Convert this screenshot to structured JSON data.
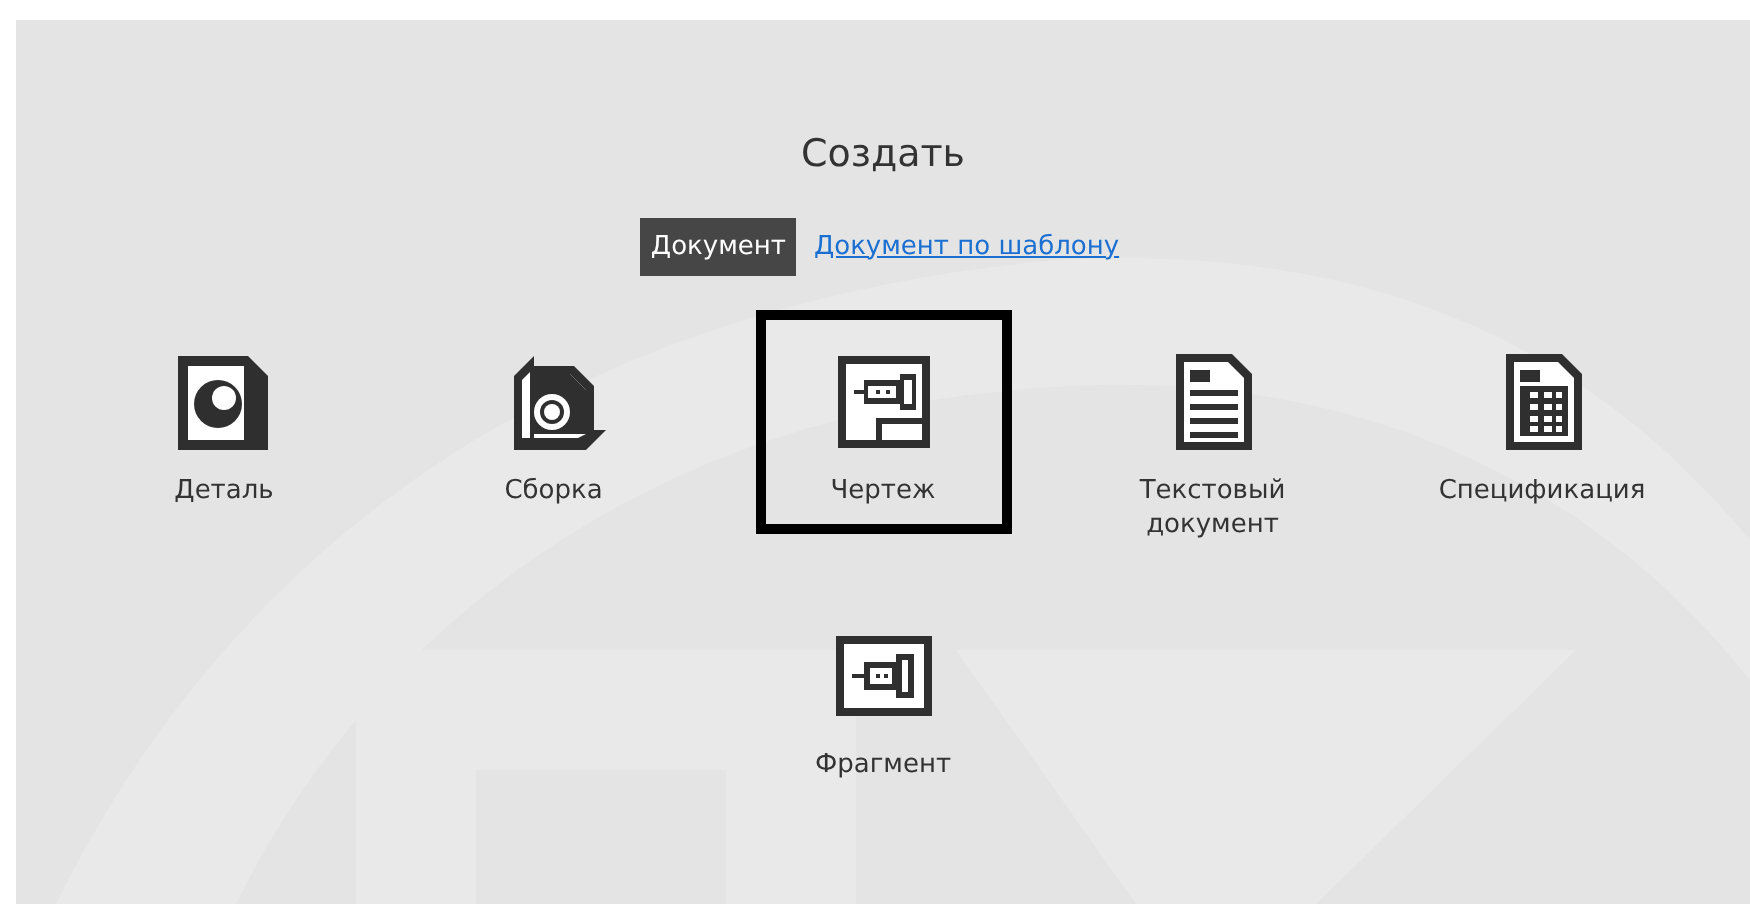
{
  "title": "Создать",
  "tabs": [
    {
      "label": "Документ",
      "selected": true
    },
    {
      "label": "Документ по шаблону",
      "selected": false
    }
  ],
  "items": [
    {
      "kind": "part",
      "label": "Деталь",
      "selected": false
    },
    {
      "kind": "assembly",
      "label": "Сборка",
      "selected": false
    },
    {
      "kind": "drawing",
      "label": "Чертеж",
      "selected": true
    },
    {
      "kind": "text",
      "label": "Текстовый документ",
      "selected": false
    },
    {
      "kind": "spec",
      "label": "Спецификация",
      "selected": false
    }
  ],
  "items_row_2": [
    {
      "kind": "fragment",
      "label": "Фрагмент",
      "selected": false
    }
  ]
}
